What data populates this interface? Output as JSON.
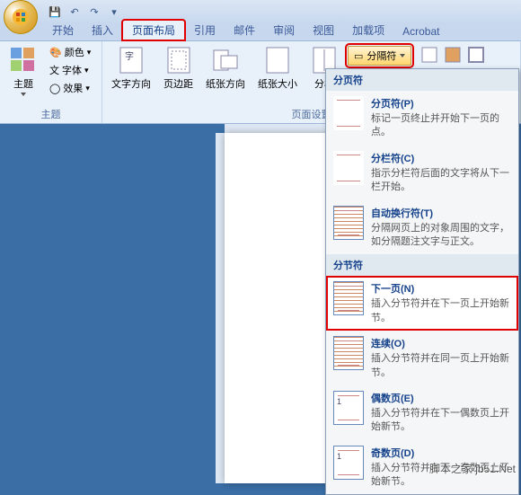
{
  "qat": {
    "save": "💾",
    "undo": "↶",
    "redo": "↷",
    "dd": "▾"
  },
  "tabs": {
    "items": [
      "开始",
      "插入",
      "页面布局",
      "引用",
      "邮件",
      "审阅",
      "视图",
      "加载项",
      "Acrobat"
    ],
    "active_index": 2,
    "highlight_index": 2
  },
  "ribbon": {
    "theme": {
      "label": "主题",
      "btn": "主题",
      "colors": "颜色",
      "fonts": "字体",
      "effects": "效果"
    },
    "page_setup": {
      "label": "页面设置",
      "text_dir": "文字方向",
      "margins": "页边距",
      "orientation": "纸张方向",
      "size": "纸张大小",
      "columns": "分栏",
      "breaks": "分隔符"
    }
  },
  "menu": {
    "section_breaks_hdr": "分页符",
    "page_break": {
      "title": "分页符(P)",
      "desc": "标记一页终止并开始下一页的点。"
    },
    "column_break": {
      "title": "分栏符(C)",
      "desc": "指示分栏符后面的文字将从下一栏开始。"
    },
    "wrap_break": {
      "title": "自动换行符(T)",
      "desc": "分隔网页上的对象周围的文字，如分隔题注文字与正文。"
    },
    "section_hdr": "分节符",
    "next_page": {
      "title": "下一页(N)",
      "desc": "插入分节符并在下一页上开始新节。"
    },
    "continuous": {
      "title": "连续(O)",
      "desc": "插入分节符并在同一页上开始新节。"
    },
    "even_page": {
      "title": "偶数页(E)",
      "desc": "插入分节符并在下一偶数页上开始新节。"
    },
    "odd_page": {
      "title": "奇数页(D)",
      "desc": "插入分节符并在下一奇数页上开始新节。"
    }
  },
  "watermark": "脚本之家 jb51.Net"
}
